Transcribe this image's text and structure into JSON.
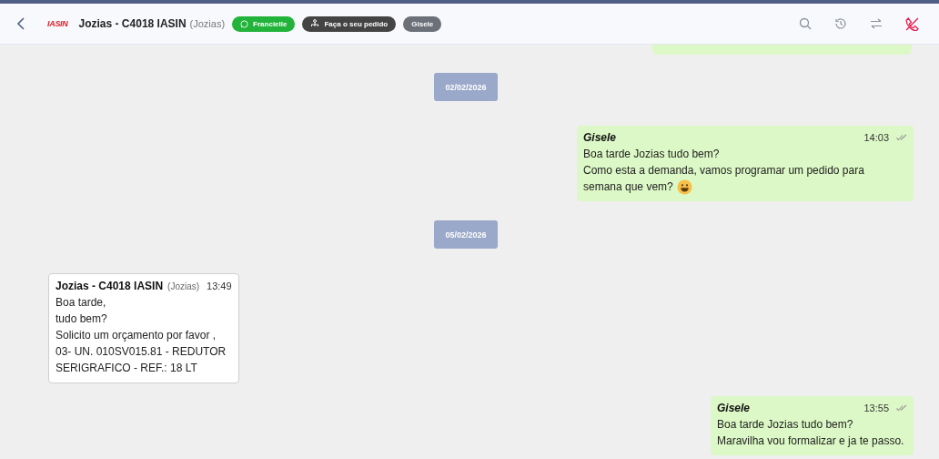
{
  "header": {
    "logo": "IASIN",
    "title": "Jozias - C4018 IASIN",
    "subtitle": "(Jozias)",
    "tags": [
      {
        "label": "Francielle",
        "kind": "whatsapp"
      },
      {
        "label": "Faça o seu pedido",
        "kind": "flow"
      },
      {
        "label": "Gisele",
        "kind": "agent"
      }
    ]
  },
  "messages": [
    {
      "kind": "partial"
    },
    {
      "kind": "date",
      "text": "02/02/2026"
    },
    {
      "kind": "outgoing",
      "author": "Gisele",
      "time": "14:03",
      "lines": [
        "Boa tarde Jozias tudo bem?",
        "Como esta a demanda, vamos programar um pedido para",
        "semana que vem?"
      ],
      "ends_with_emoji": true
    },
    {
      "kind": "date",
      "text": "05/02/2026"
    },
    {
      "kind": "incoming",
      "author": "Jozias - C4018 IASIN",
      "contact": "(Jozias)",
      "time": "13:49",
      "lines": [
        "Boa tarde,",
        "tudo bem?",
        "Solicito um orçamento por favor ,",
        "03- UN. 010SV015.81 - REDUTOR",
        "SERIGRAFICO - REF.: 18 LT"
      ]
    },
    {
      "kind": "outgoing",
      "author": "Gisele",
      "time": "13:55",
      "lines": [
        "Boa tarde Jozias tudo bem?",
        "Maravilha vou formalizar e ja te passo."
      ]
    }
  ]
}
